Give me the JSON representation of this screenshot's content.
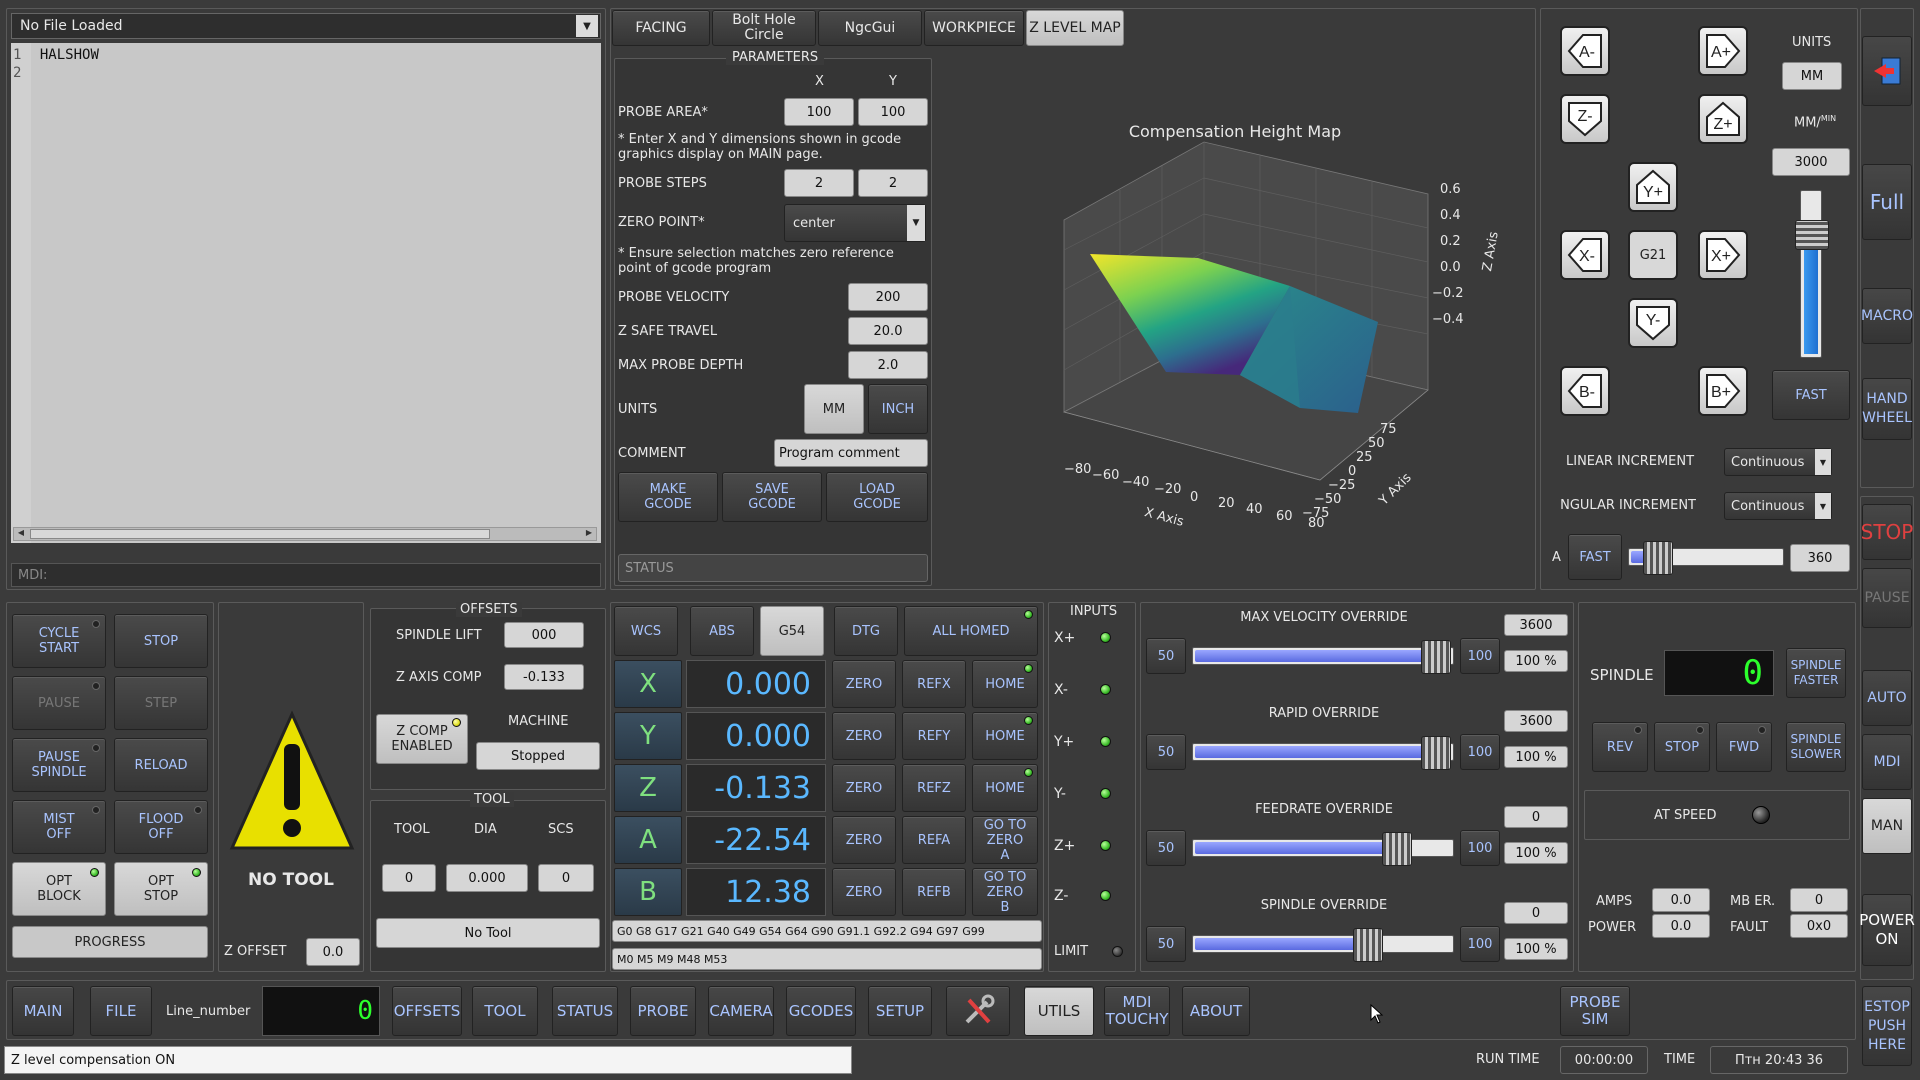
{
  "file": {
    "dropdown": "No File Loaded",
    "lines": [
      {
        "n": "1",
        "text": "HALSHOW"
      },
      {
        "n": "2",
        "text": ""
      }
    ],
    "mdi_label": "MDI:"
  },
  "tabs": [
    "FACING",
    "Bolt Hole Circle",
    "NgcGui",
    "WORKPIECE",
    "Z LEVEL MAP"
  ],
  "params": {
    "title": "PARAMETERS",
    "col_x": "X",
    "col_y": "Y",
    "probe_area_label": "PROBE AREA*",
    "probe_area_x": "100",
    "probe_area_y": "100",
    "note1": "* Enter X and Y dimensions shown in gcode graphics display on MAIN page.",
    "probe_steps_label": "PROBE STEPS",
    "probe_steps_x": "2",
    "probe_steps_y": "2",
    "zero_point_label": "ZERO POINT*",
    "zero_point_value": "center",
    "note2": "* Ensure selection matches zero reference point of gcode program",
    "probe_velocity_label": "PROBE VELOCITY",
    "probe_velocity": "200",
    "z_safe_label": "Z SAFE TRAVEL",
    "z_safe": "20.0",
    "max_depth_label": "MAX PROBE DEPTH",
    "max_depth": "2.0",
    "units_label": "UNITS",
    "units_mm": "MM",
    "units_inch": "INCH",
    "comment_label": "COMMENT",
    "comment_value": "Program comment",
    "make": "MAKE GCODE",
    "save": "SAVE GCODE",
    "load": "LOAD GCODE",
    "status_placeholder": "STATUS"
  },
  "heightmap": {
    "title": "Compensation Height Map",
    "xlabel": "X Axis",
    "ylabel": "Y Axis",
    "zlabel": "Z Axis",
    "xticks": [
      "−80",
      "−60",
      "−40",
      "−20",
      "0",
      "20",
      "40",
      "60",
      "80"
    ],
    "yticks": [
      "75",
      "50",
      "25",
      "0",
      "−25",
      "−50",
      "−75"
    ],
    "zticks": [
      "0.6",
      "0.4",
      "0.2",
      "0.0",
      "−0.2",
      "−0.4"
    ]
  },
  "jog": {
    "units_label": "UNITS",
    "units_value": "MM",
    "rate_label": "MM/",
    "rate_sup": "MIN",
    "rate_value": "3000",
    "fast": "FAST",
    "g21": "G21",
    "keys": {
      "a_minus": "A-",
      "a_plus": "A+",
      "z_minus": "Z-",
      "z_plus": "Z+",
      "y_plus": "Y+",
      "x_minus": "X-",
      "x_plus": "X+",
      "y_minus": "Y-",
      "b_minus": "B-",
      "b_plus": "B+"
    },
    "jog_rate_fraction": 0.75,
    "linear_label": "LINEAR INCREMENT",
    "linear_value": "Continuous",
    "angular_label": "ANGULAR INCREMENT",
    "angular_value": "Continuous",
    "a_label": "A",
    "a_fast": "FAST",
    "a_value": "360",
    "a_fraction": 0.05
  },
  "side": {
    "full": "Full",
    "macro": "MACRO",
    "handwheel": "HAND WHEEL",
    "stop": "STOP",
    "pause": "PAUSE",
    "auto": "AUTO",
    "mdi": "MDI",
    "man": "MAN",
    "power": "POWER ON",
    "estop": "ESTOP PUSH HERE"
  },
  "controls": {
    "cycle_start": "CYCLE START",
    "stop": "STOP",
    "pause": "PAUSE",
    "step": "STEP",
    "pause_spindle": "PAUSE SPINDLE",
    "reload": "RELOAD",
    "mist": "MIST OFF",
    "flood": "FLOOD OFF",
    "opt_block": "OPT BLOCK",
    "opt_stop": "OPT STOP",
    "progress": "PROGRESS"
  },
  "tool_warning": {
    "text": "NO TOOL",
    "z_offset_label": "Z OFFSET",
    "z_offset": "0.0"
  },
  "offsets": {
    "title": "OFFSETS",
    "spindle_lift_label": "SPINDLE LIFT",
    "spindle_lift": "000",
    "z_comp_label": "Z AXIS COMP",
    "z_comp": "-0.133",
    "z_comp_btn": "Z COMP ENABLED",
    "machine_label": "MACHINE",
    "machine_value": "Stopped"
  },
  "tool": {
    "title": "TOOL",
    "tool_label": "TOOL",
    "dia_label": "DIA",
    "scs_label": "SCS",
    "tool": "0",
    "dia": "0.000",
    "scs": "0",
    "name": "No Tool"
  },
  "dro": {
    "wcs": "WCS",
    "abs": "ABS",
    "g54": "G54",
    "dtg": "DTG",
    "all_homed": "ALL HOMED",
    "zero": "ZERO",
    "axes": [
      {
        "n": "X",
        "v": "0.000",
        "ref": "REFX",
        "home": "HOME"
      },
      {
        "n": "Y",
        "v": "0.000",
        "ref": "REFY",
        "home": "HOME"
      },
      {
        "n": "Z",
        "v": "-0.133",
        "ref": "REFZ",
        "home": "HOME"
      },
      {
        "n": "A",
        "v": "-22.54",
        "ref": "REFA",
        "home": "GO TO ZERO A"
      },
      {
        "n": "B",
        "v": "12.38",
        "ref": "REFB",
        "home": "GO TO ZERO B"
      }
    ],
    "gcodes": "G0 G8 G17 G21 G40 G49 G54 G64 G90 G91.1 G92.2 G94 G97 G99",
    "mcodes": "M0 M5 M9 M48 M53"
  },
  "inputs": {
    "title": "INPUTS",
    "items": [
      "X+",
      "X-",
      "Y+",
      "Y-",
      "Z+",
      "Z-"
    ],
    "limit": "LIMIT"
  },
  "overrides": [
    {
      "title": "MAX VELOCITY OVERRIDE",
      "min": "50",
      "max": "100",
      "value": "3600",
      "pct": "100 %",
      "fraction": 1.0
    },
    {
      "title": "RAPID OVERRIDE",
      "min": "50",
      "max": "100",
      "value": "3600",
      "pct": "100 %",
      "fraction": 1.0
    },
    {
      "title": "FEEDRATE OVERRIDE",
      "min": "50",
      "max": "100",
      "value": "0",
      "pct": "100 %",
      "fraction": 0.83
    },
    {
      "title": "SPINDLE OVERRIDE",
      "min": "50",
      "max": "100",
      "value": "0",
      "pct": "100 %",
      "fraction": 0.7
    }
  ],
  "spindle": {
    "label": "SPINDLE",
    "rpm": "0",
    "faster": "SPINDLE FASTER",
    "slower": "SPINDLE SLOWER",
    "rev": "REV",
    "stop": "STOP",
    "fwd": "FWD",
    "at_speed": "AT SPEED",
    "amps_label": "AMPS",
    "amps": "0.0",
    "mb_label": "MB ER.",
    "mb": "0",
    "power_label": "POWER",
    "power": "0.0",
    "fault_label": "FAULT",
    "fault": "0x0"
  },
  "nav": {
    "main": "MAIN",
    "file": "FILE",
    "line_number": "Line_number",
    "line_value": "0",
    "offsets": "OFFSETS",
    "tool": "TOOL",
    "status": "STATUS",
    "probe": "PROBE",
    "camera": "CAMERA",
    "gcodes": "GCODES",
    "setup": "SETUP",
    "utils": "UTILS",
    "mdi_touchy": "MDI TOUCHY",
    "about": "ABOUT",
    "probe_sim": "PROBE SIM"
  },
  "statusbar": {
    "message": "Z level compensation ON",
    "run_time_label": "RUN TIME",
    "run_time": "00:00:00",
    "time_label": "TIME",
    "time": "Птн 20:43 36"
  }
}
